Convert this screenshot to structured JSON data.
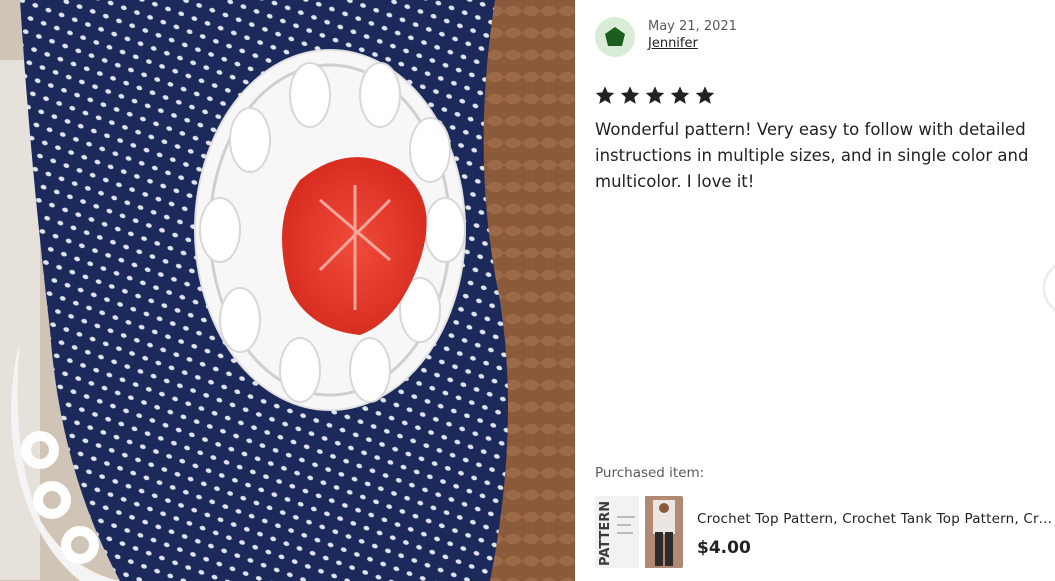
{
  "photo": {
    "description_icon": "crochet-top-photo"
  },
  "review": {
    "date": "May 21, 2021",
    "reviewer_name": "Jennifer",
    "avatar_icon": "pentagon-avatar-icon",
    "rating": 5,
    "rating_max": 5,
    "text": "Wonderful pattern! Very easy to follow with detailed instructions in multiple sizes, and in single color and multicolor. I love it!"
  },
  "purchase": {
    "label": "Purchased item:",
    "title": "Crochet Top Pattern, Crochet Tank Top Pattern, Crochet Pattern",
    "price": "$4.00",
    "thumb_text": "PATTERN"
  },
  "colors": {
    "avatar_bg": "#d9ecd7",
    "avatar_fg": "#1b5e20",
    "star": "#222222",
    "navy": "#1b2a5a",
    "flower_red": "#e8392c"
  }
}
